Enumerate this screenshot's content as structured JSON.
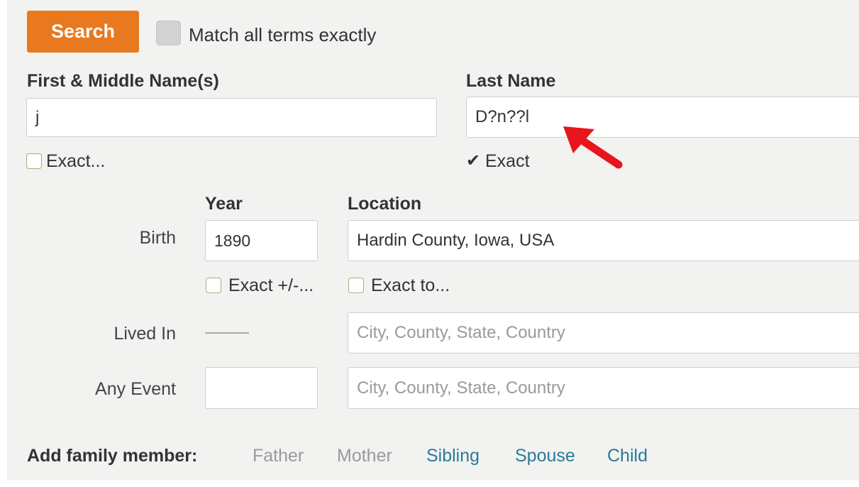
{
  "search": {
    "button_label": "Search",
    "match_all_label": "Match all terms exactly"
  },
  "first_name": {
    "label": "First & Middle Name(s)",
    "value": "j",
    "exact_label": "Exact..."
  },
  "last_name": {
    "label": "Last Name",
    "value": "D?n??l",
    "exact_check": "✔",
    "exact_label": "Exact"
  },
  "columns": {
    "year": "Year",
    "location": "Location"
  },
  "birth": {
    "label": "Birth",
    "year_value": "1890",
    "location_value": "Hardin County, Iowa, USA",
    "year_exact_label": "Exact +/-...",
    "location_exact_label": "Exact to..."
  },
  "lived_in": {
    "label": "Lived In",
    "location_placeholder": "City, County, State, Country"
  },
  "any_event": {
    "label": "Any Event",
    "year_value": "",
    "location_placeholder": "City, County, State, Country"
  },
  "family": {
    "label": "Add family member:",
    "links": [
      "Father",
      "Mother",
      "Sibling",
      "Spouse",
      "Child"
    ]
  },
  "colors": {
    "accent": "#e8791e",
    "link": "#2a7a96",
    "annotation_arrow": "#e8151b"
  }
}
